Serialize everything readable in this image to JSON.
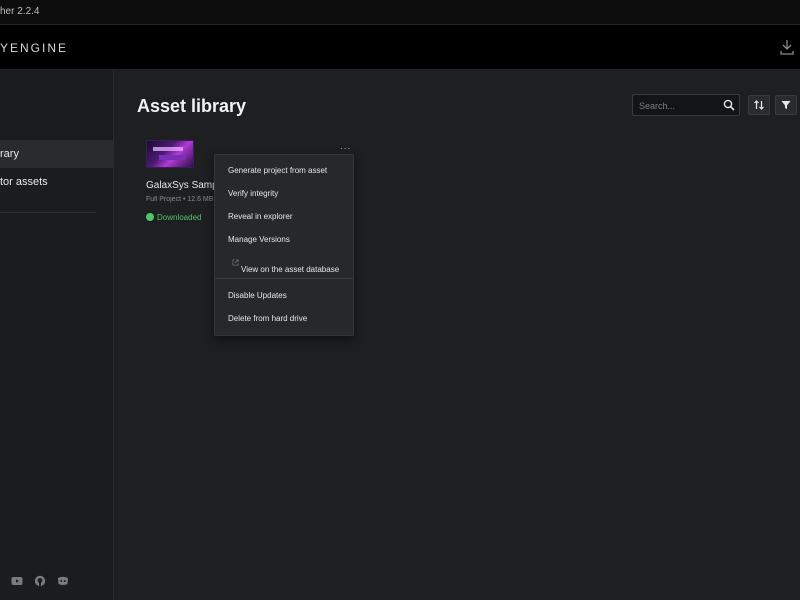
{
  "window": {
    "title": "her 2.2.4"
  },
  "topbar": {
    "logo": "YENGINE",
    "download_icon": "download-icon"
  },
  "sidebar": {
    "items": [
      {
        "label": "rary",
        "active": true
      },
      {
        "label": "tor assets",
        "active": false
      }
    ],
    "social_icons": [
      "youtube-icon",
      "github-icon",
      "discord-icon"
    ]
  },
  "main": {
    "title": "Asset library",
    "search": {
      "placeholder": "Search..."
    },
    "toolbar_icons": [
      "sort-icon",
      "filter-icon"
    ]
  },
  "asset": {
    "name": "GalaxSys Sample",
    "meta": "Full Project • 12.6 MB",
    "status": "Downloaded",
    "more_label": "..."
  },
  "context_menu": {
    "items": [
      "Generate project from asset",
      "Verify integrity",
      "Reveal in explorer",
      "Manage Versions",
      "View on the asset database",
      "Disable Updates",
      "Delete from hard drive"
    ]
  },
  "colors": {
    "background": "#1e1f21",
    "sidebar": "#1b1c1e",
    "topbar": "#000000",
    "menu": "#27282b",
    "status_green": "#52c26b"
  }
}
